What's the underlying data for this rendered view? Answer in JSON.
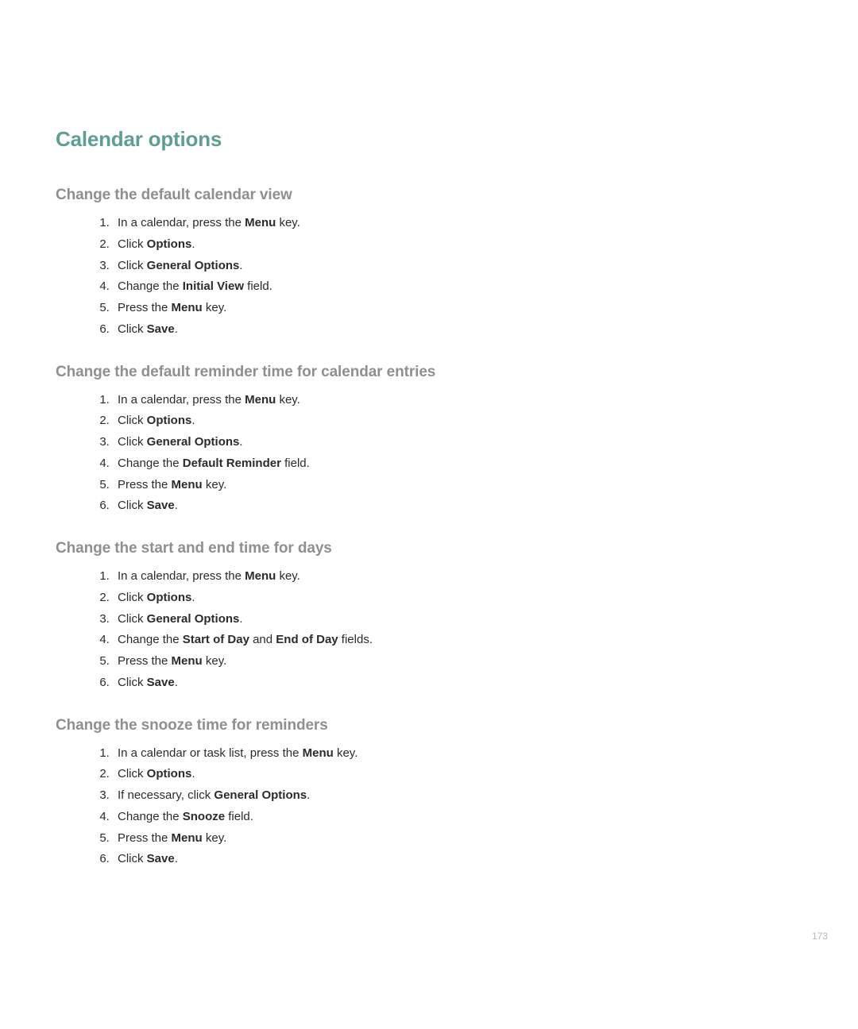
{
  "title": "Calendar options",
  "page_number": "173",
  "sections": [
    {
      "heading": "Change the default calendar view",
      "steps": [
        {
          "pre": "In a calendar, press the ",
          "bold": "Menu",
          "post": " key."
        },
        {
          "pre": "Click ",
          "bold": "Options",
          "post": "."
        },
        {
          "pre": "Click ",
          "bold": "General Options",
          "post": "."
        },
        {
          "pre": "Change the ",
          "bold": "Initial View",
          "post": " field."
        },
        {
          "pre": "Press the ",
          "bold": "Menu",
          "post": " key."
        },
        {
          "pre": "Click ",
          "bold": "Save",
          "post": "."
        }
      ]
    },
    {
      "heading": "Change the default reminder time for calendar entries",
      "steps": [
        {
          "pre": "In a calendar, press the ",
          "bold": "Menu",
          "post": " key."
        },
        {
          "pre": "Click ",
          "bold": "Options",
          "post": "."
        },
        {
          "pre": "Click ",
          "bold": "General Options",
          "post": "."
        },
        {
          "pre": "Change the ",
          "bold": "Default Reminder",
          "post": " field."
        },
        {
          "pre": "Press the ",
          "bold": "Menu",
          "post": " key."
        },
        {
          "pre": "Click ",
          "bold": "Save",
          "post": "."
        }
      ]
    },
    {
      "heading": "Change the start and end time for days",
      "steps": [
        {
          "pre": "In a calendar, press the ",
          "bold": "Menu",
          "post": " key."
        },
        {
          "pre": "Click ",
          "bold": "Options",
          "post": "."
        },
        {
          "pre": "Click ",
          "bold": "General Options",
          "post": "."
        },
        {
          "pre": "Change the ",
          "bold": "Start of Day",
          "post": " and ",
          "bold2": "End of Day",
          "post2": " fields."
        },
        {
          "pre": "Press the ",
          "bold": "Menu",
          "post": " key."
        },
        {
          "pre": "Click ",
          "bold": "Save",
          "post": "."
        }
      ]
    },
    {
      "heading": "Change the snooze time for reminders",
      "steps": [
        {
          "pre": "In a calendar or task list, press the ",
          "bold": "Menu",
          "post": " key."
        },
        {
          "pre": "Click ",
          "bold": "Options",
          "post": "."
        },
        {
          "pre": "If necessary, click ",
          "bold": "General Options",
          "post": "."
        },
        {
          "pre": "Change the ",
          "bold": "Snooze",
          "post": " field."
        },
        {
          "pre": "Press the ",
          "bold": "Menu",
          "post": " key."
        },
        {
          "pre": "Click ",
          "bold": "Save",
          "post": "."
        }
      ]
    }
  ]
}
